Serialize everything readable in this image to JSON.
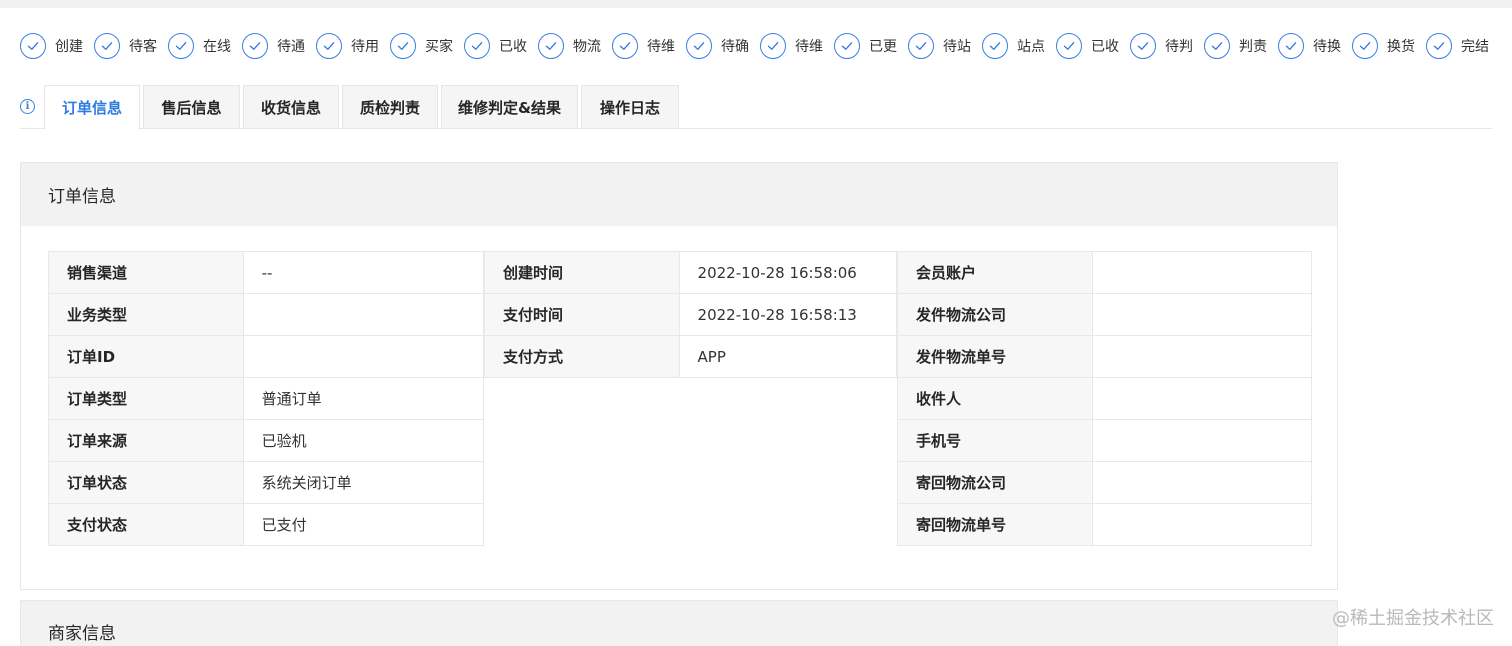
{
  "steps": [
    "创建",
    "待客",
    "在线",
    "待通",
    "待用",
    "买家",
    "已收",
    "物流",
    "待维",
    "待确",
    "待维",
    "已更",
    "待站",
    "站点",
    "已收",
    "待判",
    "判责",
    "待换",
    "换货",
    "完结"
  ],
  "tabs": [
    {
      "label": "订单信息",
      "active": true
    },
    {
      "label": "售后信息",
      "active": false
    },
    {
      "label": "收货信息",
      "active": false
    },
    {
      "label": "质检判责",
      "active": false
    },
    {
      "label": "维修判定&结果",
      "active": false
    },
    {
      "label": "操作日志",
      "active": false
    }
  ],
  "order_section": {
    "title": "订单信息",
    "col1": [
      {
        "label": "销售渠道",
        "value": "--"
      },
      {
        "label": "业务类型",
        "value": ""
      },
      {
        "label": "订单ID",
        "value": ""
      },
      {
        "label": "订单类型",
        "value": "普通订单"
      },
      {
        "label": "订单来源",
        "value": "已验机"
      },
      {
        "label": "订单状态",
        "value": "系统关闭订单"
      },
      {
        "label": "支付状态",
        "value": "已支付"
      }
    ],
    "col2": [
      {
        "label": "创建时间",
        "value": "2022-10-28 16:58:06"
      },
      {
        "label": "支付时间",
        "value": "2022-10-28 16:58:13"
      },
      {
        "label": "支付方式",
        "value": "APP"
      }
    ],
    "col3": [
      {
        "label": "会员账户",
        "value": ""
      },
      {
        "label": "发件物流公司",
        "value": ""
      },
      {
        "label": "发件物流单号",
        "value": ""
      },
      {
        "label": "收件人",
        "value": ""
      },
      {
        "label": "手机号",
        "value": ""
      },
      {
        "label": "寄回物流公司",
        "value": ""
      },
      {
        "label": "寄回物流单号",
        "value": ""
      }
    ]
  },
  "merchant_section": {
    "title": "商家信息"
  },
  "watermark": "@稀土掘金技术社区",
  "colors": {
    "accent": "#2f7de1",
    "header_bg": "#f2f2f2",
    "border": "#e8e8e8"
  },
  "icons": {
    "step": "check-circle-icon",
    "info": "info-circle-icon"
  }
}
